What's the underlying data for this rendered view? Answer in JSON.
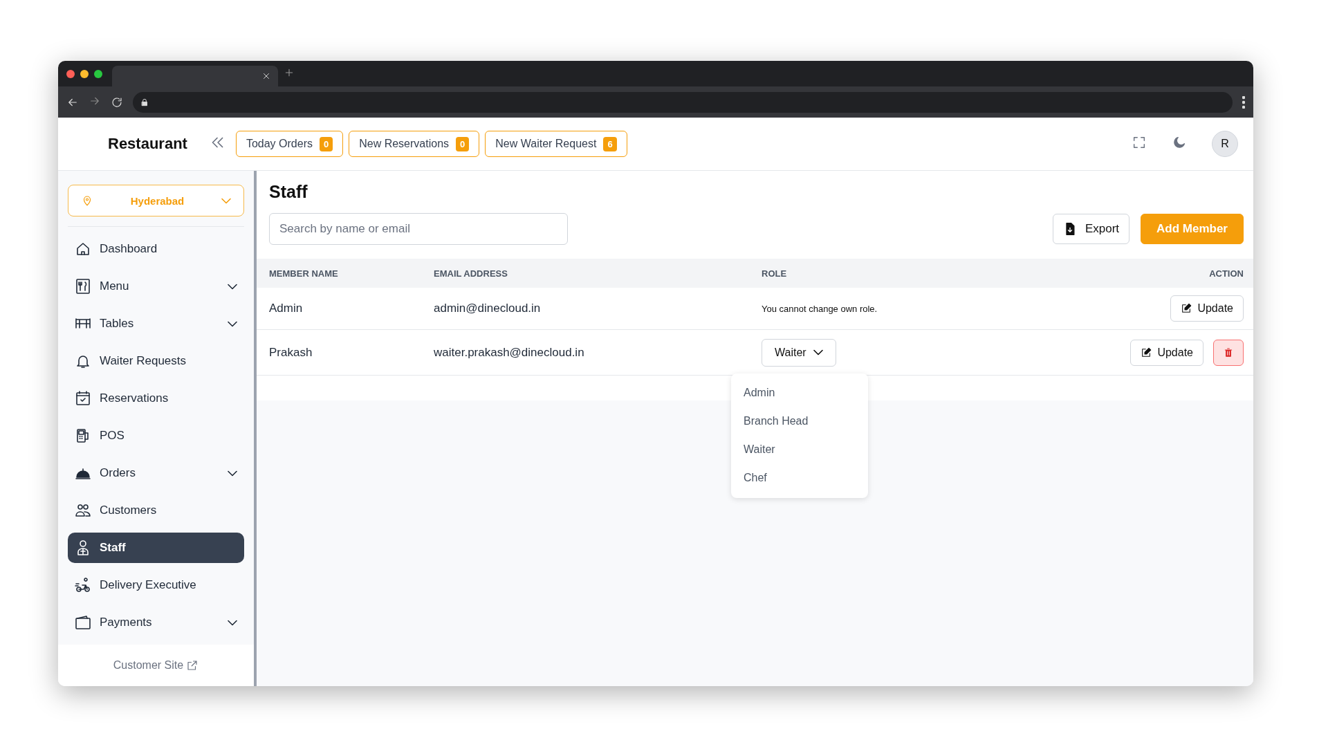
{
  "header": {
    "title": "Restaurant",
    "badges": [
      {
        "label": "Today Orders",
        "count": "0"
      },
      {
        "label": "New Reservations",
        "count": "0"
      },
      {
        "label": "New Waiter Request",
        "count": "6"
      }
    ],
    "avatar": "R"
  },
  "sidebar": {
    "branch": "Hyderabad",
    "items": [
      {
        "label": "Dashboard",
        "expandable": false,
        "selected": false
      },
      {
        "label": "Menu",
        "expandable": true,
        "selected": false
      },
      {
        "label": "Tables",
        "expandable": true,
        "selected": false
      },
      {
        "label": "Waiter Requests",
        "expandable": false,
        "selected": false
      },
      {
        "label": "Reservations",
        "expandable": false,
        "selected": false
      },
      {
        "label": "POS",
        "expandable": false,
        "selected": false
      },
      {
        "label": "Orders",
        "expandable": true,
        "selected": false
      },
      {
        "label": "Customers",
        "expandable": false,
        "selected": false
      },
      {
        "label": "Staff",
        "expandable": false,
        "selected": true
      },
      {
        "label": "Delivery Executive",
        "expandable": false,
        "selected": false
      },
      {
        "label": "Payments",
        "expandable": true,
        "selected": false
      }
    ],
    "footer_link": "Customer Site"
  },
  "page": {
    "title": "Staff",
    "search": {
      "placeholder": "Search by name or email"
    },
    "export_button": "Export",
    "add_button": "Add Member"
  },
  "table": {
    "columns": [
      "MEMBER NAME",
      "EMAIL ADDRESS",
      "ROLE",
      "ACTION"
    ],
    "rows": [
      {
        "name": "Admin",
        "email": "admin@dinecloud.in",
        "role": {
          "kind": "note",
          "text": "You cannot change own role."
        },
        "actions": [
          {
            "kind": "update",
            "label": "Update"
          }
        ]
      },
      {
        "name": "Prakash",
        "email": "waiter.prakash@dinecloud.in",
        "role": {
          "kind": "select",
          "value": "Waiter",
          "expanded": true,
          "options": [
            "Admin",
            "Branch Head",
            "Waiter",
            "Chef"
          ]
        },
        "actions": [
          {
            "kind": "update",
            "label": "Update"
          },
          {
            "kind": "delete"
          }
        ]
      }
    ]
  }
}
